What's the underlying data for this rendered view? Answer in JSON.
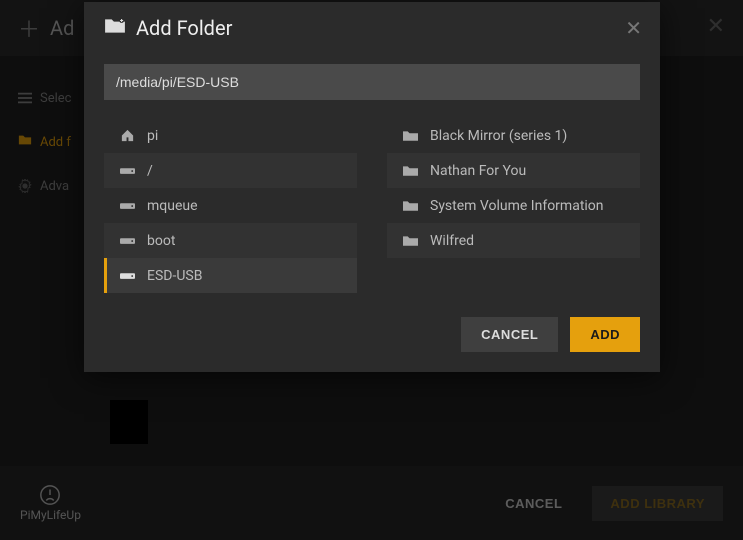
{
  "bg": {
    "title": "Ad",
    "sidebar": {
      "select": "Selec",
      "addf": "Add f",
      "adva": "Adva"
    },
    "footer": {
      "logo": "PiMyLifeUp",
      "cancel": "CANCEL",
      "add_library": "ADD LIBRARY"
    }
  },
  "modal": {
    "title": "Add Folder",
    "path": "/media/pi/ESD-USB",
    "drives": [
      {
        "name": "pi",
        "icon": "home"
      },
      {
        "name": "/",
        "icon": "drive"
      },
      {
        "name": "mqueue",
        "icon": "drive"
      },
      {
        "name": "boot",
        "icon": "drive"
      },
      {
        "name": "ESD-USB",
        "icon": "drive",
        "selected": true
      }
    ],
    "folders": [
      {
        "name": "Black Mirror (series 1)"
      },
      {
        "name": "Nathan For You"
      },
      {
        "name": "System Volume Information"
      },
      {
        "name": "Wilfred"
      }
    ],
    "cancel": "CANCEL",
    "add": "ADD"
  }
}
